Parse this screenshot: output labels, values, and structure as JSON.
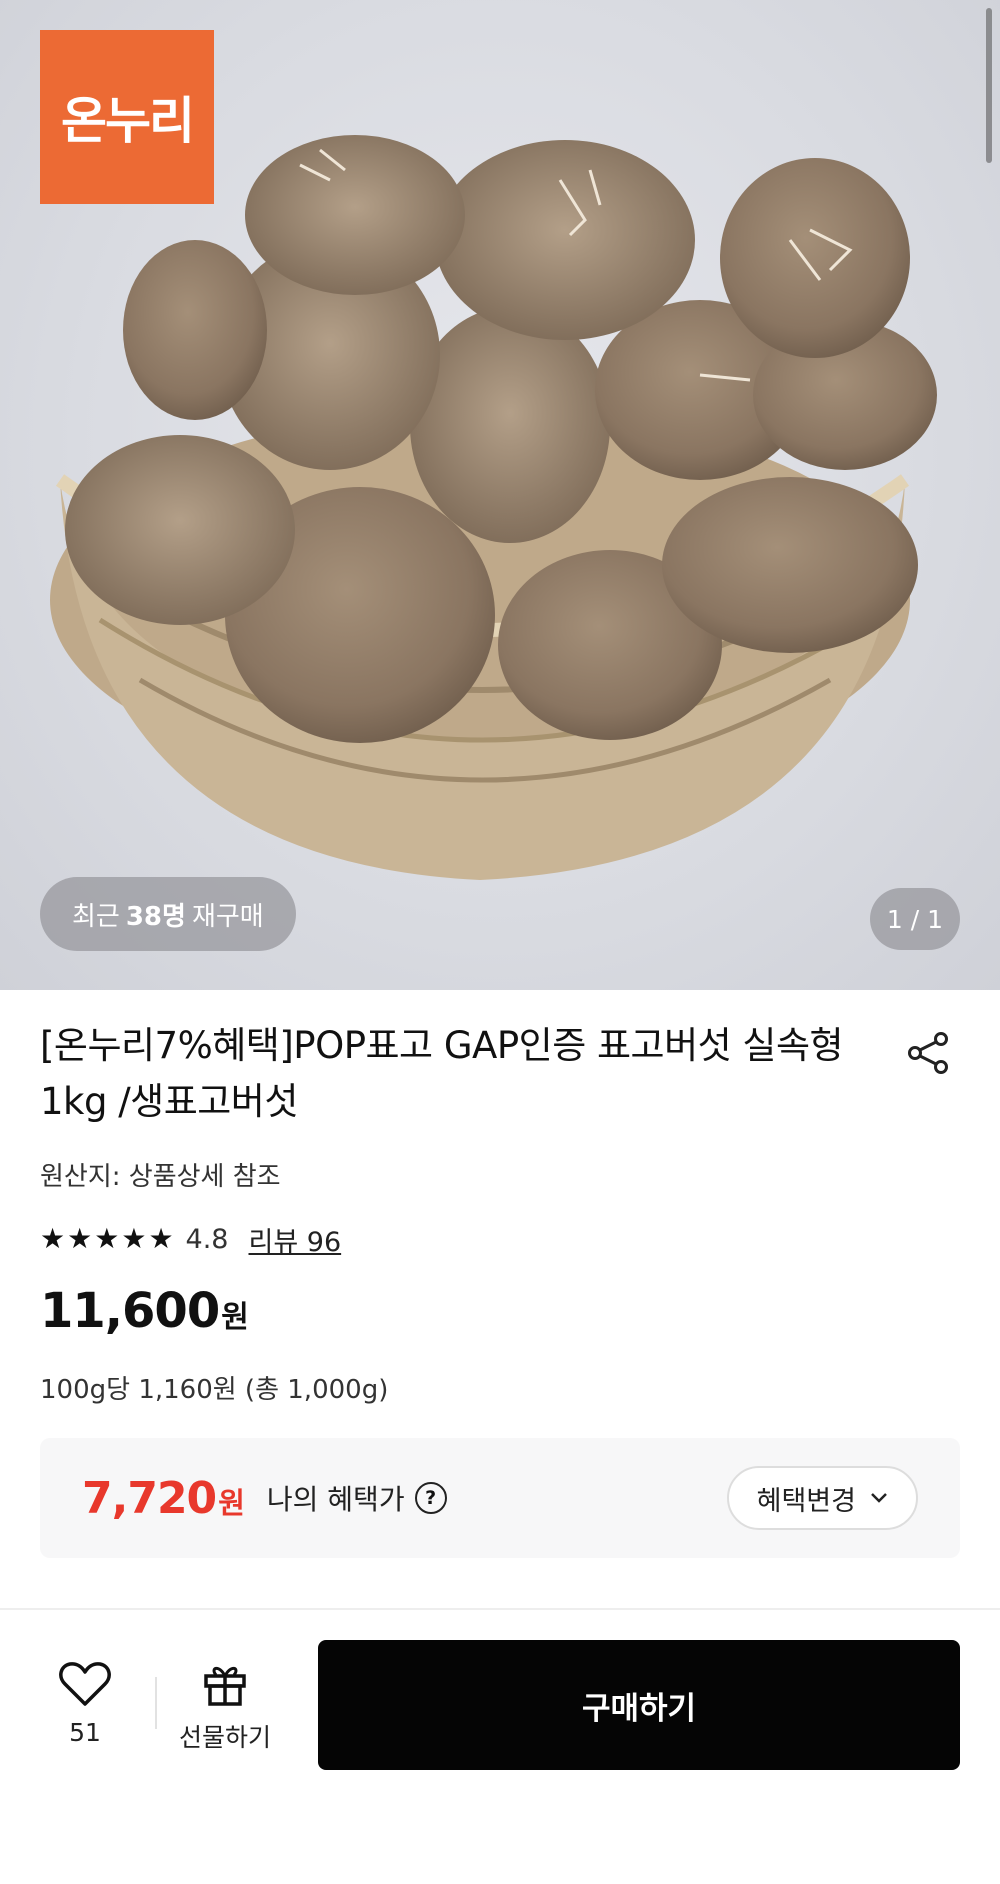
{
  "hero": {
    "logo_text": "온누리",
    "rebuy_prefix": "최근",
    "rebuy_count": "38명",
    "rebuy_suffix": "재구매",
    "pager": "1 / 1"
  },
  "product": {
    "title": "[온누리7%혜택]POP표고 GAP인증 표고버섯 실속형 1kg /생표고버섯",
    "share_icon": "share-icon",
    "origin": "원산지: 상품상세 참조",
    "stars": [
      "★",
      "★",
      "★",
      "★",
      "★"
    ],
    "rating": "4.8",
    "review_link": "리뷰 96",
    "price": "11,600",
    "price_unit": "원",
    "unit_price": "100g당 1,160원 (총 1,000g)"
  },
  "benefit": {
    "price": "7,720",
    "price_unit": "원",
    "label": "나의 혜택가",
    "help_icon": "?",
    "change_label": "혜택변경",
    "accent_color": "#e8382c"
  },
  "action_bar": {
    "like_count": "51",
    "gift_label": "선물하기",
    "buy_label": "구매하기"
  },
  "colors": {
    "logo_bg": "#ec6a34",
    "buy_button_bg": "#050505"
  }
}
